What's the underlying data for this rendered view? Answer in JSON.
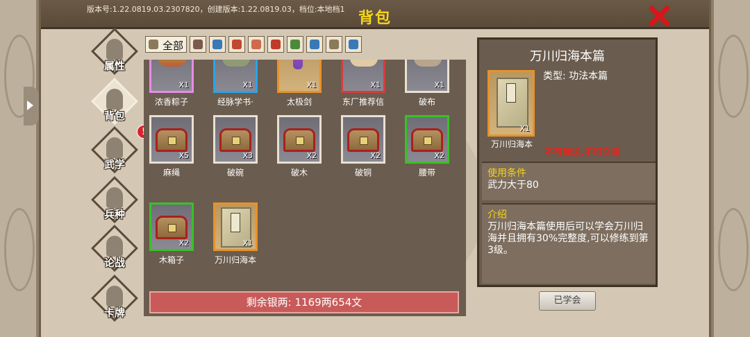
{
  "header": {
    "version_text": "版本号:1.22.0819.03.2307820，创建版本:1.22.0819.03，档位:本地档1",
    "title": "背包"
  },
  "nav": [
    {
      "label": "属性",
      "icon": "person-icon",
      "active": false
    },
    {
      "label": "背包",
      "icon": "bag-icon",
      "active": true
    },
    {
      "label": "武学",
      "icon": "book-icon",
      "active": false,
      "alert": "!"
    },
    {
      "label": "兵种",
      "icon": "horse-icon",
      "active": false
    },
    {
      "label": "论战",
      "icon": "speech-icon",
      "active": false
    },
    {
      "label": "卡牌",
      "icon": "cards-icon",
      "active": false
    }
  ],
  "tabs": [
    {
      "label": "全部",
      "icon": "bag-icon",
      "color": "#8a7a5a"
    },
    {
      "label": "",
      "icon": "sword-icon",
      "color": "#7a5a4a"
    },
    {
      "label": "",
      "icon": "book-blue-icon",
      "color": "#3a78b8"
    },
    {
      "label": "",
      "icon": "armor-icon",
      "color": "#c04a30"
    },
    {
      "label": "",
      "icon": "scroll-icon",
      "color": "#d06a4a"
    },
    {
      "label": "",
      "icon": "hat-icon",
      "color": "#c03a2a"
    },
    {
      "label": "",
      "icon": "herb-icon",
      "color": "#4a8a3a"
    },
    {
      "label": "",
      "icon": "book-blue-icon",
      "color": "#3a78b8"
    },
    {
      "label": "",
      "icon": "scroll-brown-icon",
      "color": "#8a7a5a"
    },
    {
      "label": "",
      "icon": "book-blue-icon",
      "color": "#3a78b8"
    }
  ],
  "items": [
    {
      "name": "浓香粽子",
      "qty": "X1",
      "rarity": "pink",
      "art": "zong"
    },
    {
      "name": "经脉学书·",
      "qty": "X1",
      "rarity": "blue",
      "art": "scroll"
    },
    {
      "name": "太极剑",
      "qty": "X1",
      "rarity": "orange",
      "art": "sword"
    },
    {
      "name": "东厂推荐信",
      "qty": "X1",
      "rarity": "red",
      "art": "letter"
    },
    {
      "name": "破布",
      "qty": "X1",
      "rarity": "white",
      "art": "cloth"
    },
    {
      "name": "麻绳",
      "qty": "X5",
      "rarity": "white",
      "art": "chest"
    },
    {
      "name": "破碗",
      "qty": "X3",
      "rarity": "white",
      "art": "chest"
    },
    {
      "name": "破木",
      "qty": "X2",
      "rarity": "white",
      "art": "chest"
    },
    {
      "name": "破铜",
      "qty": "X2",
      "rarity": "white",
      "art": "chest"
    },
    {
      "name": "腰带",
      "qty": "X2",
      "rarity": "green",
      "art": "chest"
    },
    {
      "name": "木箱子",
      "qty": "X2",
      "rarity": "green",
      "art": "chest"
    },
    {
      "name": "万川归海本",
      "qty": "X1",
      "rarity": "orange",
      "art": "book"
    }
  ],
  "silver_text": "剩余银两: 1169两654文",
  "detail": {
    "title": "万川归海本篇",
    "type": "类型: 功法本篇",
    "item_name": "万川归海本",
    "qty": "X1",
    "warning": "不可赠送,不可交易",
    "condition_head": "使用条件",
    "condition": "武力大于80",
    "intro_head": "介绍",
    "intro": "万川归海本篇使用后可以学会万川归海并且拥有30%完整度,可以修练到第3级。"
  },
  "learned_button": "已学会"
}
